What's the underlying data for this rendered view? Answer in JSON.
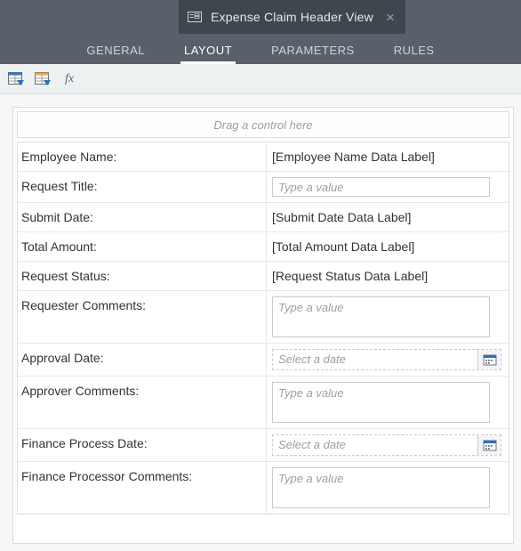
{
  "header": {
    "title": "Expense Claim Header View"
  },
  "subtabs": {
    "general": "GENERAL",
    "layout": "LAYOUT",
    "parameters": "PARAMETERS",
    "rules": "RULES"
  },
  "dropzone": "Drag a control here",
  "fields": {
    "employee_name": {
      "label": "Employee Name:",
      "value": "[Employee Name Data Label]"
    },
    "request_title": {
      "label": "Request Title:",
      "placeholder": "Type a value"
    },
    "submit_date": {
      "label": "Submit Date:",
      "value": "[Submit Date Data Label]"
    },
    "total_amount": {
      "label": "Total Amount:",
      "value": "[Total Amount Data Label]"
    },
    "request_status": {
      "label": "Request Status:",
      "value": "[Request Status Data Label]"
    },
    "requester_comments": {
      "label": "Requester Comments:",
      "placeholder": "Type a value"
    },
    "approval_date": {
      "label": "Approval Date:",
      "placeholder": "Select a date"
    },
    "approver_comments": {
      "label": "Approver Comments:",
      "placeholder": "Type a value"
    },
    "finance_process_date": {
      "label": "Finance Process Date:",
      "placeholder": "Select a date"
    },
    "finance_processor_comments": {
      "label": "Finance Processor Comments:",
      "placeholder": "Type a value"
    }
  }
}
